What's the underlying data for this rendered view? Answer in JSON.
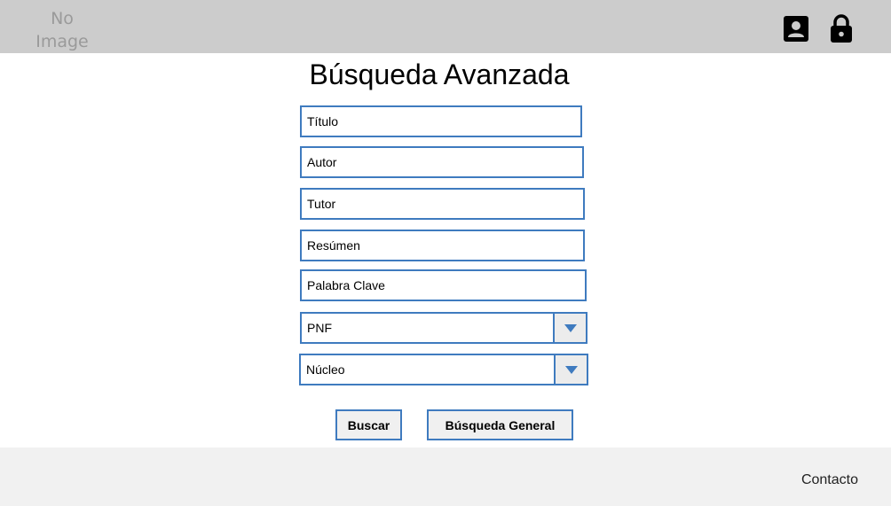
{
  "header": {
    "logo_line1": "No",
    "logo_line2": "Image"
  },
  "page_title": "Búsqueda Avanzada",
  "form": {
    "titulo_placeholder": "Título",
    "autor_placeholder": "Autor",
    "tutor_placeholder": "Tutor",
    "resumen_placeholder": "Resúmen",
    "palabra_clave_placeholder": "Palabra Clave",
    "pnf_selected": "PNF",
    "nucleo_selected": "Núcleo"
  },
  "buttons": {
    "buscar": "Buscar",
    "busqueda_general": "Búsqueda General"
  },
  "footer": {
    "contacto": "Contacto"
  },
  "colors": {
    "header_bg": "#cccccc",
    "field_border": "#3f7bbf",
    "footer_bg": "#f1f1f1"
  }
}
